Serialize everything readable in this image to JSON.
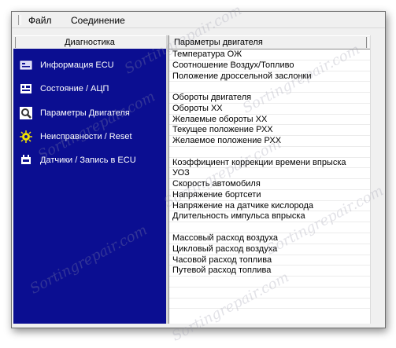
{
  "menu": {
    "file": "Файл",
    "connection": "Соединение"
  },
  "sidebar": {
    "header": "Диагностика",
    "items": [
      {
        "label": "Информация ECU",
        "icon": "info-icon"
      },
      {
        "label": "Состояние / АЦП",
        "icon": "status-icon"
      },
      {
        "label": "Параметры Двигателя",
        "icon": "magnifier-icon"
      },
      {
        "label": "Неисправности / Reset",
        "icon": "warning-icon"
      },
      {
        "label": "Датчики / Запись в ECU",
        "icon": "sensor-icon"
      }
    ]
  },
  "list": {
    "header": "Параметры двигателя",
    "rows": [
      "Температура ОЖ",
      "Соотношение Воздух/Топливо",
      "Положение дроссельной заслонки",
      "",
      "Обороты двигателя",
      "Обороты ХХ",
      "Желаемые обороты ХХ",
      "Текущее положение РХХ",
      "Желаемое положение РХХ",
      "",
      "Коэффициент коррекции времени впрыска",
      "УОЗ",
      "Скорость автомобиля",
      "Напряжение бортсети",
      "Напряжение на датчике кислорода",
      "Длительность импульса впрыска",
      "",
      "Массовый расход воздуха",
      "Цикловый расход воздуха",
      "Часовой расход топлива",
      "Путевой расход топлива",
      "",
      "",
      ""
    ]
  },
  "watermark": "Sortingrepair.com"
}
